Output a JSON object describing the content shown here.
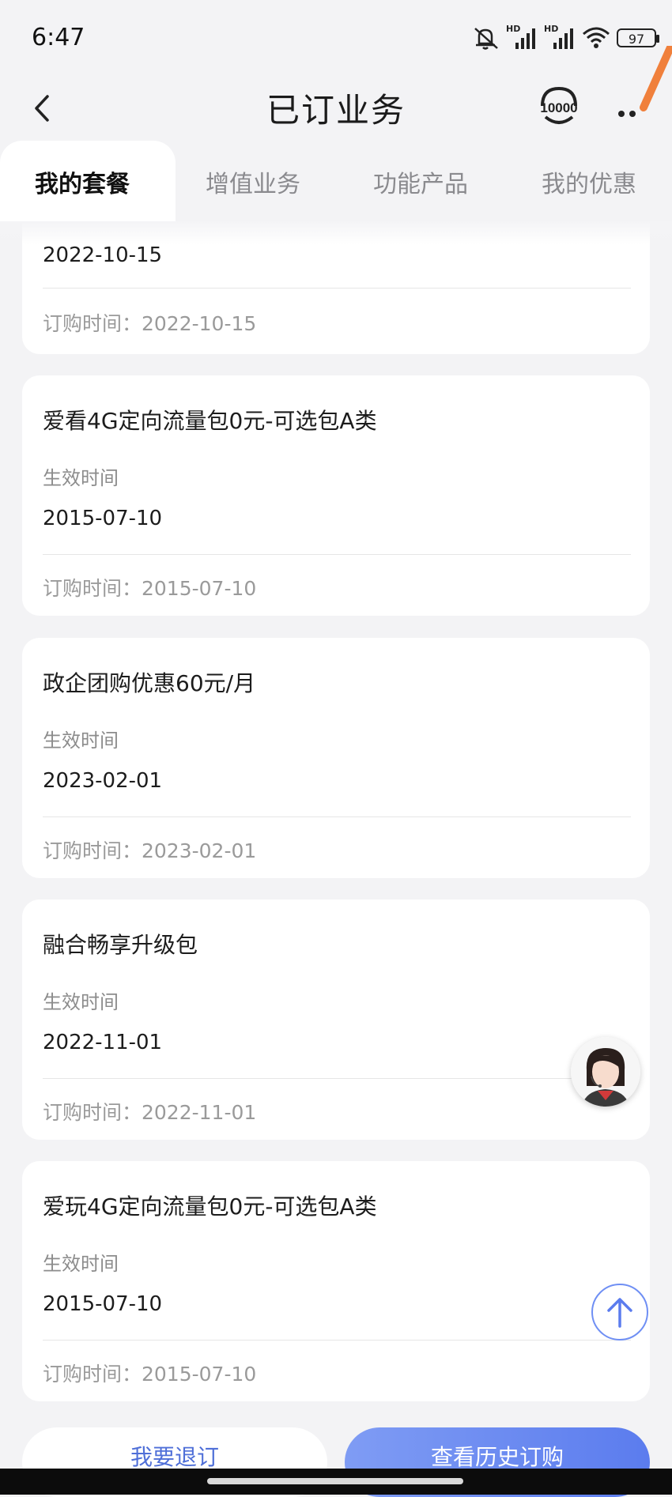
{
  "status_bar": {
    "time": "6:47",
    "battery": "97",
    "network_1": "HD",
    "network_2": "HD"
  },
  "nav": {
    "title": "已订业务",
    "hotline_icon": "10000"
  },
  "tabs": [
    {
      "label": "我的套餐",
      "active": true
    },
    {
      "label": "增值业务",
      "active": false
    },
    {
      "label": "功能产品",
      "active": false
    },
    {
      "label": "我的优惠",
      "active": false
    }
  ],
  "partial_card": {
    "effective_date": "2022-10-15",
    "order_time": "订购时间：2022-10-15"
  },
  "cards": [
    {
      "name": "爱看4G定向流量包0元-可选包A类",
      "effective_label": "生效时间",
      "effective_date": "2015-07-10",
      "order_time": "订购时间：2015-07-10"
    },
    {
      "name": "政企团购优惠60元/月",
      "effective_label": "生效时间",
      "effective_date": "2023-02-01",
      "order_time": "订购时间：2023-02-01"
    },
    {
      "name": "融合畅享升级包",
      "effective_label": "生效时间",
      "effective_date": "2022-11-01",
      "order_time": "订购时间：2022-11-01"
    },
    {
      "name": "爱玩4G定向流量包0元-可选包A类",
      "effective_label": "生效时间",
      "effective_date": "2015-07-10",
      "order_time": "订购时间：2015-07-10"
    }
  ],
  "buttons": {
    "unsubscribe": "我要退订",
    "history": "查看历史订购"
  },
  "colors": {
    "accent": "#5b7cee",
    "orange_stroke": "#f0803c"
  }
}
